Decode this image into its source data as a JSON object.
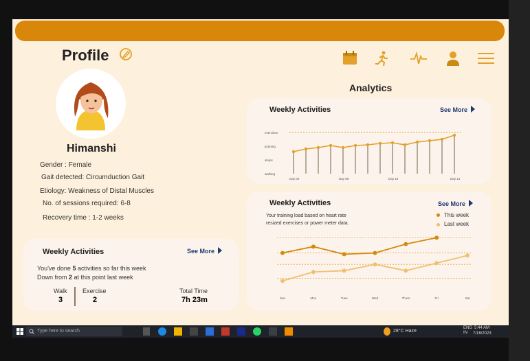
{
  "profile": {
    "title": "Profile",
    "name": "Himanshi",
    "gender": "Gender :  Female",
    "gait": "Gait detected:   Circumduction Gait",
    "etiology": "Etiology:  Weakness of Distal Muscles",
    "sessions": "No. of sessions required:  6-8",
    "recovery": "Recovery time : 1-2 weeks"
  },
  "weekly_left": {
    "title": "Weekly Activities",
    "see_more": "See More",
    "line1_pre": "You've done ",
    "line1_num": "5",
    "line1_post": " activities so far this week",
    "line2_pre": "Down from ",
    "line2_num": "2",
    "line2_post": " at this point last week",
    "walk_label": "Walk",
    "walk_value": "3",
    "exercise_label": "Exercise",
    "exercise_value": "2",
    "total_label": "Total Time",
    "total_value": "7h 23m"
  },
  "nav": {
    "icons": [
      "calendar-icon",
      "running-icon",
      "heartbeat-icon",
      "user-icon",
      "menu-icon"
    ]
  },
  "analytics": {
    "title": "Analytics"
  },
  "chart1_card": {
    "title": "Weekly Activities",
    "see_more": "See More"
  },
  "chart2_card": {
    "title": "Weekly Activities",
    "see_more": "See More",
    "desc_line1": "Your training load based on heart rate",
    "desc_line2": "resized exercises or power meter data.",
    "legend_this": "This week",
    "legend_last": "Last week"
  },
  "chart_data": [
    {
      "type": "line",
      "yticks": [
        "exercises",
        "jumping",
        "situps",
        "walking"
      ],
      "xticks": [
        "Day 00",
        "Day 05",
        "Day 10",
        "Day 14"
      ],
      "x": [
        0,
        1,
        2,
        3,
        4,
        5,
        6,
        7,
        8,
        9,
        10,
        11,
        12,
        13,
        14
      ],
      "values": [
        1.6,
        1.8,
        1.9,
        2.05,
        1.9,
        2.05,
        2.1,
        2.2,
        2.25,
        2.1,
        2.3,
        2.4,
        2.5,
        2.8
      ],
      "color": "#e3a02a"
    },
    {
      "type": "line",
      "categories": [
        "Sun",
        "Mon",
        "Tues",
        "Wed",
        "Thurs",
        "Fri",
        "Sat"
      ],
      "series": [
        {
          "name": "This week",
          "values": [
            3.0,
            3.5,
            2.9,
            3.0,
            3.7,
            4.2,
            null
          ],
          "color": "#d48a0f"
        },
        {
          "name": "Last week",
          "values": [
            0.8,
            1.5,
            1.6,
            2.1,
            1.6,
            2.2,
            2.8
          ],
          "color": "#f0c070"
        }
      ],
      "ylim": [
        0,
        4.6
      ]
    }
  ],
  "taskbar": {
    "search_placeholder": "Type here to search",
    "weather": "28°C  Haze",
    "time": "5:44 AM",
    "date": "7/16/2023",
    "lang": "ENG IN"
  },
  "colors": {
    "accent": "#d9870a",
    "background": "#fdf0dc",
    "card": "#fbf3ec",
    "link": "#1f3a70"
  }
}
